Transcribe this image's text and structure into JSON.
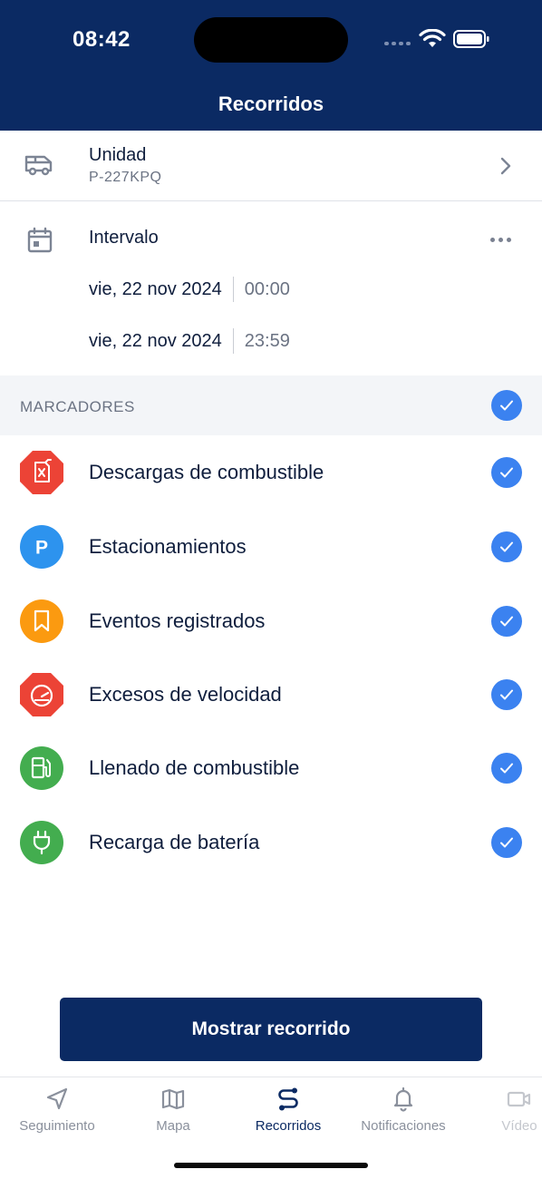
{
  "status_bar": {
    "time": "08:42"
  },
  "header": {
    "title": "Recorridos"
  },
  "unit": {
    "title": "Unidad",
    "plate": "P-227KPQ",
    "icon": "van-icon"
  },
  "interval": {
    "title": "Intervalo",
    "start": {
      "date": "vie, 22 nov 2024",
      "time": "00:00"
    },
    "end": {
      "date": "vie, 22 nov 2024",
      "time": "23:59"
    }
  },
  "markers_section": {
    "label": "MARCADORES",
    "all_selected": true
  },
  "markers": [
    {
      "label": "Descargas de combustible",
      "icon": "fuel-discharge-icon",
      "color": "#ec4336",
      "checked": true
    },
    {
      "label": "Estacionamientos",
      "icon": "parking-icon",
      "color": "#2d93ee",
      "checked": true
    },
    {
      "label": "Eventos registrados",
      "icon": "bookmark-icon",
      "color": "#fb9a10",
      "checked": true
    },
    {
      "label": "Excesos de velocidad",
      "icon": "speedometer-icon",
      "color": "#ec4336",
      "checked": true
    },
    {
      "label": "Llenado de combustible",
      "icon": "fuel-pump-icon",
      "color": "#43ad4f",
      "checked": true
    },
    {
      "label": "Recarga de batería",
      "icon": "plug-icon",
      "color": "#43ad4f",
      "checked": true
    }
  ],
  "primary_button": {
    "label": "Mostrar recorrido"
  },
  "tabs": [
    {
      "label": "Seguimiento",
      "icon": "navigation-arrow-icon",
      "active": false
    },
    {
      "label": "Mapa",
      "icon": "map-icon",
      "active": false
    },
    {
      "label": "Recorridos",
      "icon": "route-icon",
      "active": true
    },
    {
      "label": "Notificaciones",
      "icon": "bell-icon",
      "active": false
    },
    {
      "label": "Vídeo",
      "icon": "video-icon",
      "active": false
    }
  ],
  "colors": {
    "brand": "#0b2a63",
    "accent": "#3b82f0"
  }
}
